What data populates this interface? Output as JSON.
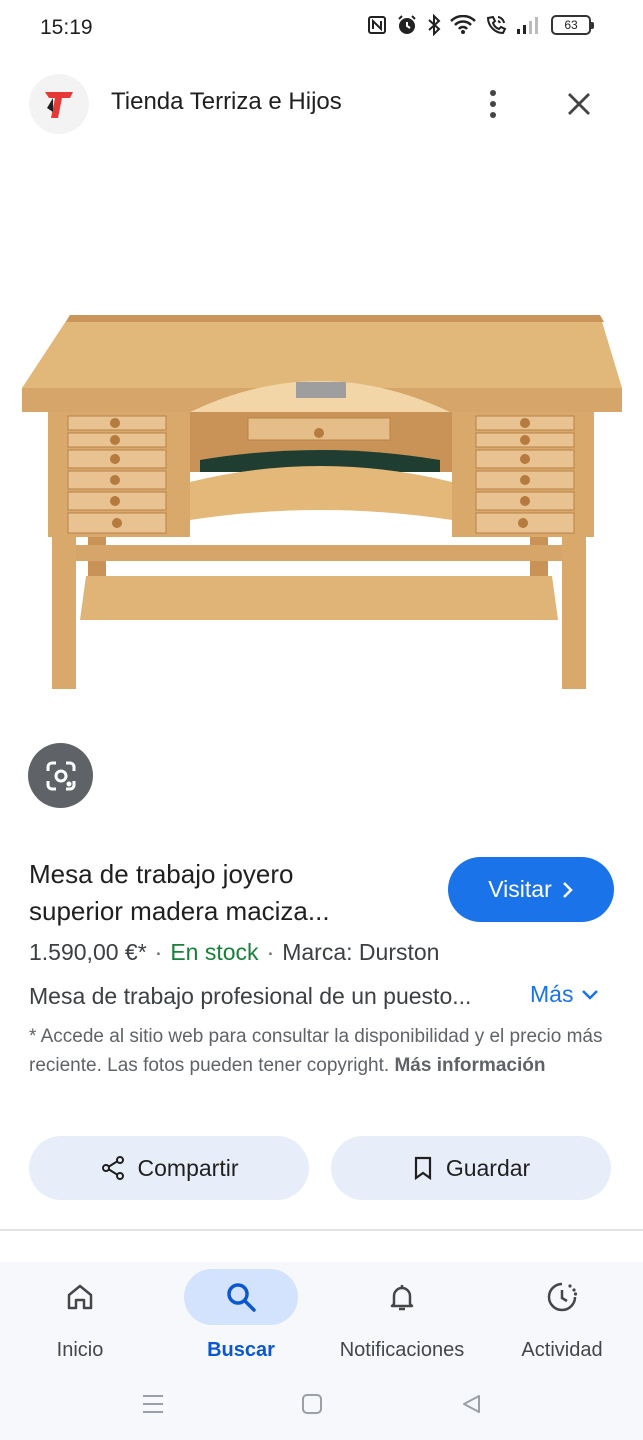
{
  "status_bar": {
    "time": "15:19",
    "battery": "63",
    "icons": [
      "nfc-icon",
      "alarm-icon",
      "bluetooth-icon",
      "wifi-icon",
      "wifi-call-icon",
      "signal-icon",
      "battery-icon"
    ]
  },
  "header": {
    "store_name": "Tienda Terriza e Hijos",
    "logo_color": "#e53935"
  },
  "product": {
    "title_line1": "Mesa de trabajo joyero",
    "title_line2": "superior madera maciza...",
    "visit_label": "Visitar",
    "price": "1.590,00 €*",
    "stock": "En stock",
    "brand": "Marca: Durston",
    "description": "Mesa de trabajo profesional de un puesto...",
    "more_label": "Más",
    "disclaimer": "* Accede al sitio web para consultar la disponibilidad y el precio más reciente. Las fotos pueden tener copyright.",
    "disclaimer_link": "Más información",
    "share_label": "Compartir",
    "save_label": "Guardar"
  },
  "bottom_nav": {
    "items": [
      {
        "label": "Inicio",
        "icon": "home-icon",
        "active": false
      },
      {
        "label": "Buscar",
        "icon": "search-icon",
        "active": true
      },
      {
        "label": "Notificaciones",
        "icon": "bell-icon",
        "active": false
      },
      {
        "label": "Actividad",
        "icon": "activity-icon",
        "active": false
      }
    ]
  },
  "colors": {
    "accent": "#1a73e8",
    "stock_green": "#188038",
    "chip_bg": "#e8eef9",
    "nav_active_bg": "#d3e3fd"
  }
}
